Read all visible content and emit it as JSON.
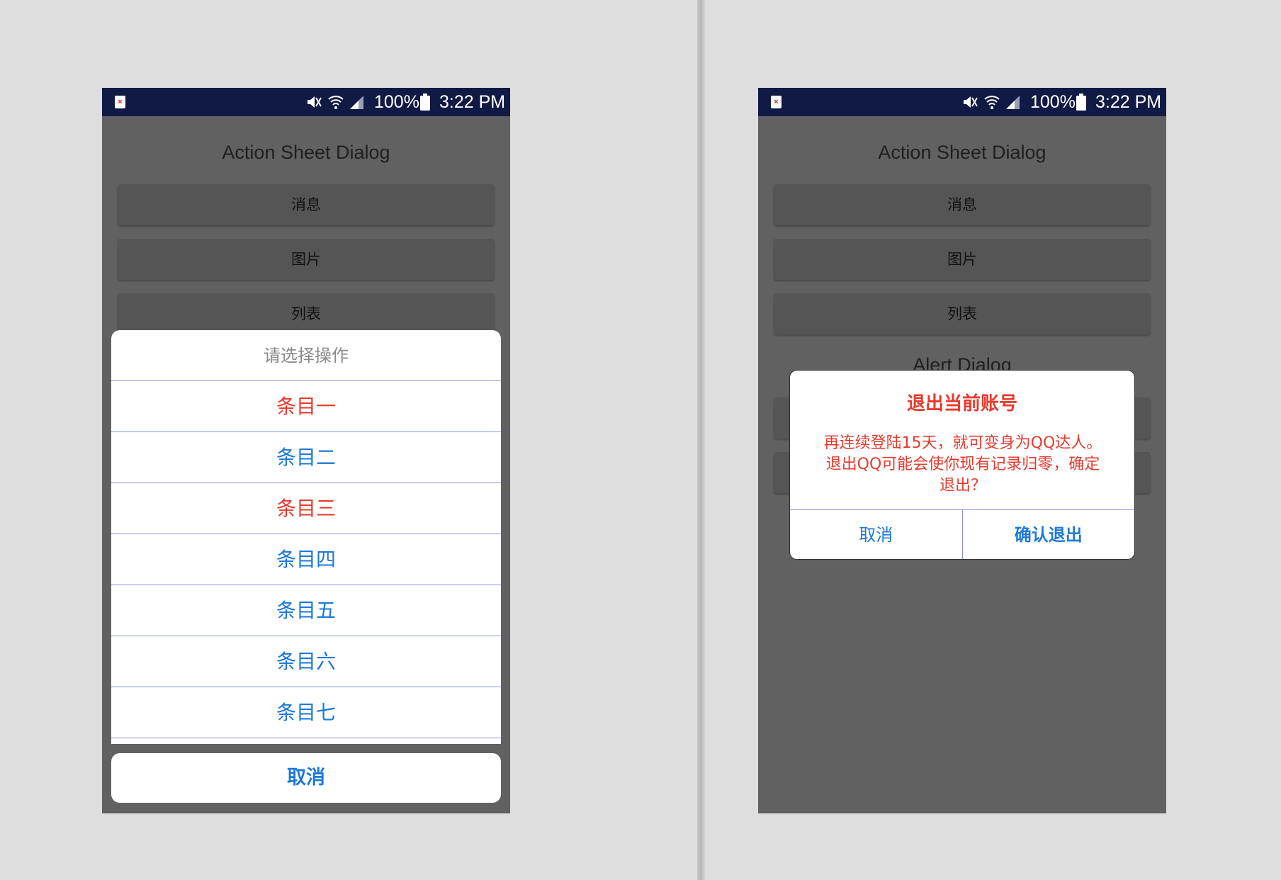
{
  "status_bar": {
    "battery": "100%",
    "time": "3:22 PM",
    "app_icon_glyph": "×",
    "icons": [
      "notification-app-icon",
      "mute-icon",
      "wifi-icon",
      "signal-icon",
      "battery-icon"
    ]
  },
  "app": {
    "title": "Action Sheet Dialog",
    "buttons": [
      "消息",
      "图片",
      "列表"
    ],
    "alert_section_title": "Alert Dialog"
  },
  "action_sheet": {
    "title": "请选择操作",
    "items": [
      "条目一",
      "条目二",
      "条目三",
      "条目四",
      "条目五",
      "条目六",
      "条目七"
    ],
    "cancel": "取消"
  },
  "alert_dialog": {
    "title": "退出当前账号",
    "message": "再连续登陆15天，就可变身为QQ达人。退出QQ可能会使你现有记录归零，确定退出？",
    "cancel": "取消",
    "confirm": "确认退出"
  },
  "colors": {
    "status_bar": "#111a45",
    "dim_background": "#616161",
    "accent_red": "#e63b2e",
    "accent_blue": "#1d78d8",
    "divider": "#8d92d6"
  }
}
